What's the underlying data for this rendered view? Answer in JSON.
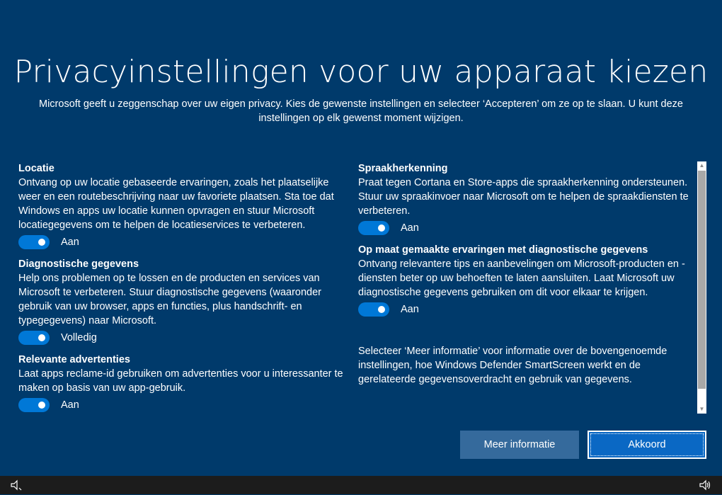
{
  "header": {
    "title": "Privacyinstellingen voor uw apparaat kiezen",
    "subtitle": "Microsoft geeft u zeggenschap over uw eigen privacy. Kies de gewenste instellingen en selecteer ‘Accepteren’ om ze op te slaan. U kunt deze instellingen op elk gewenst moment wijzigen."
  },
  "settings": {
    "left": [
      {
        "title": "Locatie",
        "description": "Ontvang op uw locatie gebaseerde ervaringen, zoals het plaatselijke weer en een routebeschrijving naar uw favoriete plaatsen. Sta toe dat Windows en apps uw locatie kunnen opvragen en stuur Microsoft locatiegegevens om te helpen de locatieservices te verbeteren.",
        "toggle_label": "Aan"
      },
      {
        "title": "Diagnostische gegevens",
        "description": "Help ons problemen op te lossen en de producten en services van Microsoft te verbeteren. Stuur diagnostische gegevens (waaronder gebruik van uw browser, apps en functies, plus handschrift- en typegegevens) naar Microsoft.",
        "toggle_label": "Volledig"
      },
      {
        "title": "Relevante advertenties",
        "description": "Laat apps reclame-id gebruiken om advertenties voor u interessanter te maken op basis van uw app-gebruik.",
        "toggle_label": "Aan"
      }
    ],
    "right": [
      {
        "title": "Spraakherkenning",
        "description": "Praat tegen Cortana en Store-apps die spraakherkenning ondersteunen. Stuur uw spraakinvoer naar Microsoft om te helpen de spraakdiensten te verbeteren.",
        "toggle_label": "Aan"
      },
      {
        "title": "Op maat gemaakte ervaringen met diagnostische gegevens",
        "description": "Ontvang relevantere tips en aanbevelingen om Microsoft-producten en -diensten beter op uw behoeften te laten aansluiten. Laat Microsoft uw diagnostische gegevens gebruiken om dit voor elkaar te krijgen.",
        "toggle_label": "Aan"
      }
    ],
    "info_text": "Selecteer ‘Meer informatie’ voor informatie over de bovengenoemde instellingen, hoe Windows Defender SmartScreen werkt en de gerelateerde gegevensoverdracht en gebruik van gegevens."
  },
  "buttons": {
    "more_info": "Meer informatie",
    "accept": "Akkoord"
  },
  "scrollbar": {
    "up_glyph": "▲",
    "down_glyph": "▼"
  },
  "taskbar": {
    "left_icon": "ease-of-access-icon",
    "right_icon": "volume-icon"
  },
  "colors": {
    "background": "#003a6b",
    "toggle_on": "#0078d7",
    "accept_button": "#0a68c4",
    "more_button": "#356a9c"
  }
}
